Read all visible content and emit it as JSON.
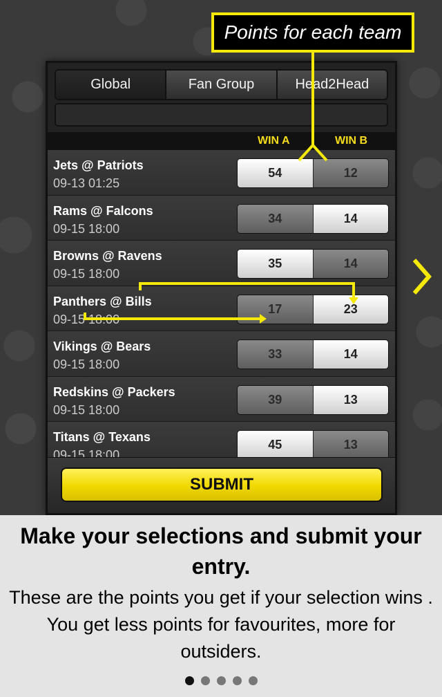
{
  "tabs": [
    {
      "label": "Global",
      "active": true
    },
    {
      "label": "Fan Group",
      "active": false
    },
    {
      "label": "Head2Head",
      "active": false
    }
  ],
  "columns": {
    "win_a": "WIN A",
    "win_b": "WIN B"
  },
  "matches": [
    {
      "match": "Jets @ Patriots",
      "time": "09-13 01:25",
      "win_a": "54",
      "win_b": "12",
      "selected": "b"
    },
    {
      "match": "Rams @ Falcons",
      "time": "09-15 18:00",
      "win_a": "34",
      "win_b": "14",
      "selected": "a"
    },
    {
      "match": "Browns @ Ravens",
      "time": "09-15 18:00",
      "win_a": "35",
      "win_b": "14",
      "selected": "b"
    },
    {
      "match": "Panthers @ Bills",
      "time": "09-15 18:00",
      "win_a": "17",
      "win_b": "23",
      "selected": "a"
    },
    {
      "match": "Vikings @ Bears",
      "time": "09-15 18:00",
      "win_a": "33",
      "win_b": "14",
      "selected": "a"
    },
    {
      "match": "Redskins @ Packers",
      "time": "09-15 18:00",
      "win_a": "39",
      "win_b": "13",
      "selected": "a"
    },
    {
      "match": "Titans @ Texans",
      "time": "09-15 18:00",
      "win_a": "45",
      "win_b": "13",
      "selected": "b"
    }
  ],
  "submit_label": "SUBMIT",
  "callout": "Points for each team",
  "footer": {
    "title": "Make your selections and submit your entry.",
    "body": "These are the points you get if your selection wins . You get less points for favourites, more for outsiders."
  },
  "pagination": {
    "count": 5,
    "active": 0
  },
  "colors": {
    "accent": "#f5e90a",
    "button": "#f0d800",
    "background": "#3a3a3a",
    "footer": "#e4e4e4"
  },
  "icons": {
    "next": "chevron-right-icon"
  }
}
